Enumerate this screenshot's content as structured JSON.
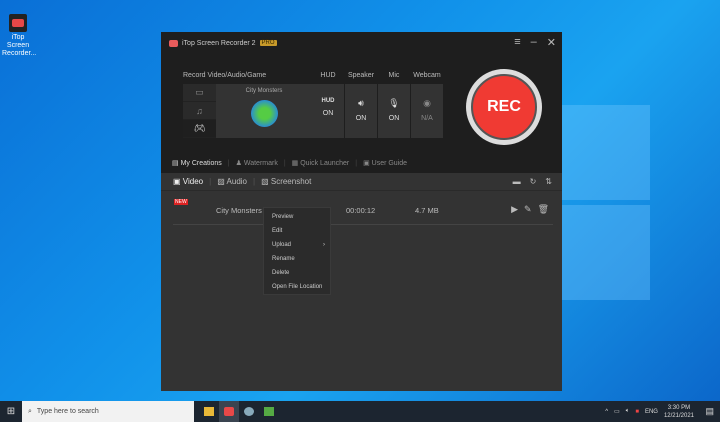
{
  "desktop": {
    "icon_label": "iTop Screen Recorder...",
    "accent": "#1192ea"
  },
  "app": {
    "title": "iTop Screen Recorder 2",
    "badge": "PRO",
    "record_label": "Record Video/Audio/Game",
    "game_name": "City Monsters",
    "toggles": [
      {
        "label": "HUD",
        "icon": "HUD",
        "value": "ON"
      },
      {
        "label": "Speaker",
        "icon": "speaker-icon",
        "value": "ON"
      },
      {
        "label": "Mic",
        "icon": "mic-icon",
        "value": "ON"
      },
      {
        "label": "Webcam",
        "icon": "webcam-icon",
        "value": "N/A"
      }
    ],
    "rec_label": "REC",
    "rec_color": "#f03a33",
    "nav": [
      "My Creations",
      "Watermark",
      "Quick Launcher",
      "User Guide"
    ],
    "tabs": [
      "Video",
      "Audio",
      "Screenshot"
    ],
    "rows": [
      {
        "badge": "NEW",
        "name": "City Monsters",
        "duration": "00:00:12",
        "size": "4.7 MB"
      }
    ]
  },
  "context_menu": [
    "Preview",
    "Edit",
    "Upload",
    "Rename",
    "Delete",
    "Open File Location"
  ],
  "taskbar": {
    "search_placeholder": "Type here to search",
    "lang": "ENG",
    "time": "3:30 PM",
    "date": "12/21/2021"
  }
}
